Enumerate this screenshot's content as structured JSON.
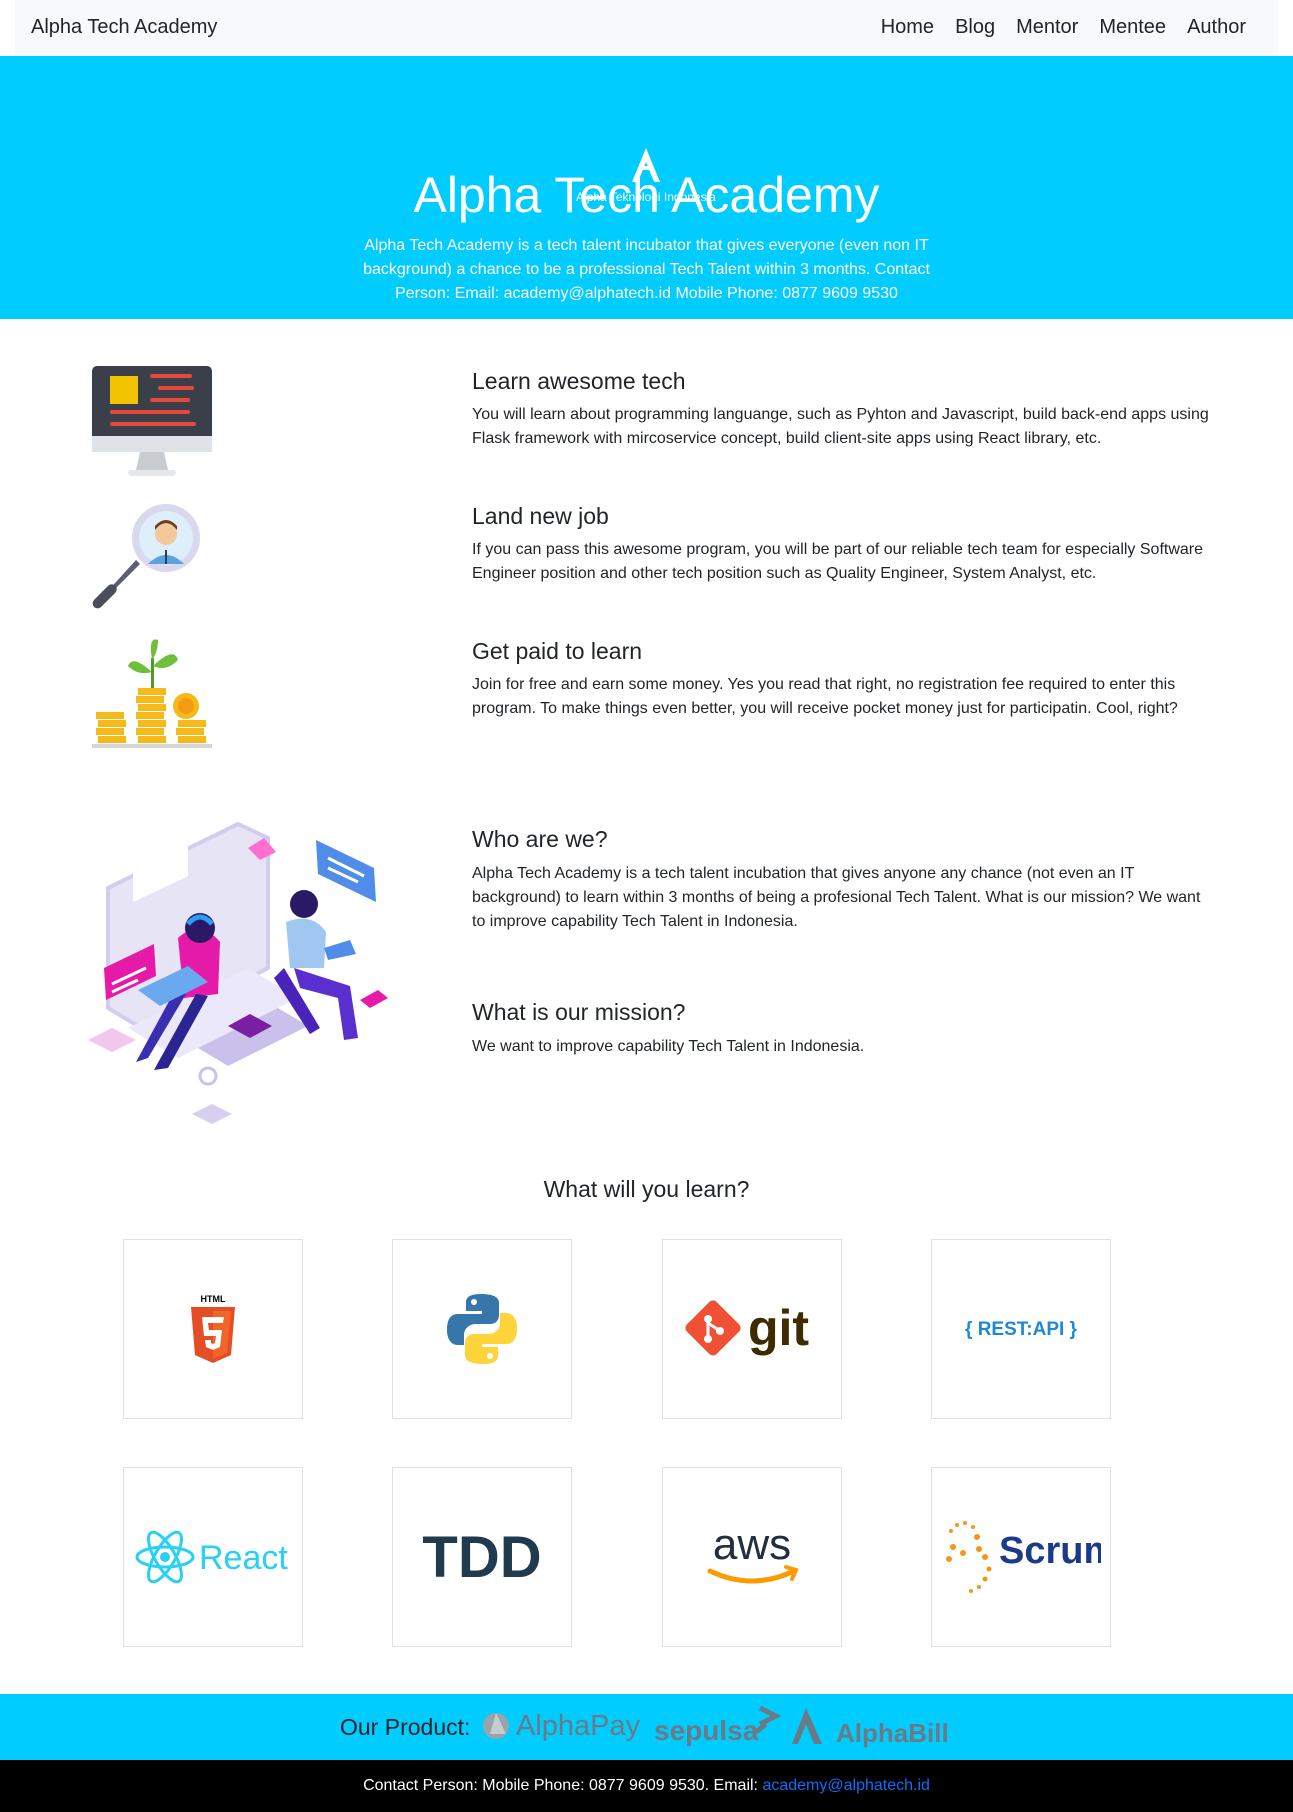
{
  "navbar": {
    "brand": "Alpha Tech Academy",
    "links": [
      "Home",
      "Blog",
      "Mentor",
      "Mentee",
      "Author"
    ]
  },
  "hero": {
    "logo_text": "Alpha Teknologi Indonesia",
    "title": "Alpha Tech Academy",
    "description": "Alpha Tech Academy is a tech talent incubator that gives everyone (even non IT background) a chance to be a professional Tech Talent within 3 months. Contact Person: Email: academy@alphatech.id Mobile Phone: 0877 9609 9530"
  },
  "features": [
    {
      "title": "Learn awesome tech",
      "text": "You will learn about programming languange, such as Pyhton and Javascript, build back-end apps using Flask framework with mircoservice concept, build client-site apps using React library, etc."
    },
    {
      "title": "Land new job",
      "text": "If you can pass this awesome program, you will be part of our reliable tech team for especially Software Engineer position and other tech position such as Quality Engineer, System Analyst, etc."
    },
    {
      "title": "Get paid to learn",
      "text": "Join for free and earn some money. Yes you read that right, no registration fee required to enter this program. To make things even better, you will receive pocket money just for participatin. Cool, right?"
    }
  ],
  "about": {
    "who_title": "Who are we?",
    "who_text": "Alpha Tech Academy is a tech talent incubation that gives anyone any chance (not even an IT background) to learn within 3 months of being a profesional Tech Talent. What is our mission? We want to improve capability Tech Talent in Indonesia.",
    "mission_title": "What is our mission?",
    "mission_text": "We want to improve capability Tech Talent in Indonesia."
  },
  "learn": {
    "title": "What will you learn?",
    "tiles": [
      {
        "name": "html5",
        "label": "HTML"
      },
      {
        "name": "python",
        "label": ""
      },
      {
        "name": "git",
        "label": "git"
      },
      {
        "name": "rest-api",
        "label": "{ REST:API }"
      },
      {
        "name": "react",
        "label": "React"
      },
      {
        "name": "tdd",
        "label": "TDD"
      },
      {
        "name": "aws",
        "label": "aws"
      },
      {
        "name": "scrum",
        "label": "Scrum"
      }
    ]
  },
  "products": {
    "label": "Our Product:",
    "items": [
      "AlphaPay",
      "sepulsa",
      "AlphaBill"
    ]
  },
  "footer": {
    "text": "Contact Person: Mobile Phone: 0877 9609 9530. Email: ",
    "email": "academy@alphatech.id"
  },
  "colors": {
    "accent": "#00ccff",
    "navbar_bg": "#f8f9fa",
    "footer_bg": "#000000",
    "link": "#0d6efd"
  }
}
